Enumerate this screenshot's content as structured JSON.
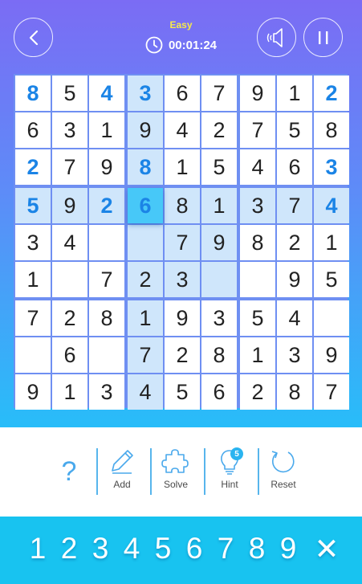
{
  "header": {
    "difficulty": "Easy",
    "timer": "00:01:24",
    "icons": {
      "back": "chevron-left-icon",
      "sound": "speaker-icon",
      "pause": "pause-icon",
      "clock": "clock-icon"
    }
  },
  "board": {
    "cells": [
      [
        "8",
        "5",
        "4",
        "3",
        "6",
        "7",
        "9",
        "1",
        "2"
      ],
      [
        "6",
        "3",
        "1",
        "9",
        "4",
        "2",
        "7",
        "5",
        "8"
      ],
      [
        "2",
        "7",
        "9",
        "8",
        "1",
        "5",
        "4",
        "6",
        "3"
      ],
      [
        "5",
        "9",
        "2",
        "6",
        "8",
        "1",
        "3",
        "7",
        "4"
      ],
      [
        "3",
        "4",
        "",
        "",
        "7",
        "9",
        "8",
        "2",
        "1"
      ],
      [
        "1",
        "",
        "7",
        "2",
        "3",
        "",
        "",
        "9",
        "5"
      ],
      [
        "7",
        "2",
        "8",
        "1",
        "9",
        "3",
        "5",
        "4",
        ""
      ],
      [
        "",
        "6",
        "",
        "7",
        "2",
        "8",
        "1",
        "3",
        "9"
      ],
      [
        "9",
        "1",
        "3",
        "4",
        "5",
        "6",
        "2",
        "8",
        "7"
      ]
    ],
    "given_highlight": [
      [
        0,
        0
      ],
      [
        0,
        2
      ],
      [
        0,
        3
      ],
      [
        0,
        8
      ],
      [
        2,
        0
      ],
      [
        2,
        3
      ],
      [
        2,
        8
      ],
      [
        3,
        0
      ],
      [
        3,
        2
      ],
      [
        3,
        3
      ],
      [
        3,
        8
      ]
    ],
    "selected": [
      3,
      3
    ],
    "colors": {
      "grid": "#6f8ff2",
      "highlight": "#cfe6fb",
      "selected": "#47c8f8",
      "given": "#1b84e6"
    }
  },
  "tools": {
    "help_label": "?",
    "add_label": "Add",
    "solve_label": "Solve",
    "hint_label": "Hint",
    "hint_count": "5",
    "reset_label": "Reset"
  },
  "numpad": {
    "digits": [
      "1",
      "2",
      "3",
      "4",
      "5",
      "6",
      "7",
      "8",
      "9"
    ],
    "clear_label": "✕"
  }
}
